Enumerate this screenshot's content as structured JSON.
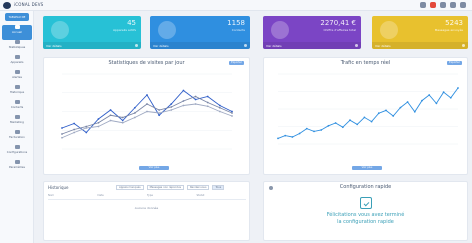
{
  "header": {
    "brand": "iCONAL DEVS",
    "icons": [
      "flag-icon",
      "bell-icon",
      "user-icon",
      "settings-icon",
      "logout-icon"
    ]
  },
  "sidebar": {
    "top_button": "TABLEAU DE BORD",
    "items": [
      {
        "label": "Accueil",
        "icon": "home-icon",
        "active": true
      },
      {
        "label": "Statistiques",
        "icon": "chart-icon",
        "active": false
      },
      {
        "label": "Appareils",
        "icon": "device-icon",
        "active": false
      },
      {
        "label": "Alertes",
        "icon": "alert-icon",
        "active": false
      },
      {
        "label": "Historique",
        "icon": "history-icon",
        "active": false
      },
      {
        "label": "Contacts",
        "icon": "contact-icon",
        "active": false
      },
      {
        "label": "Marketing",
        "icon": "megaphone-icon",
        "active": false
      },
      {
        "label": "Facturation",
        "icon": "invoice-icon",
        "active": false
      },
      {
        "label": "Configurations",
        "icon": "gear-icon",
        "active": false
      },
      {
        "label": "Paramètres",
        "icon": "sliders-icon",
        "active": false
      }
    ]
  },
  "cards": [
    {
      "value": "45",
      "desc": "Appareils actifs",
      "foot": "Voir détails",
      "color": "#27c1d6"
    },
    {
      "value": "1158",
      "desc": "Contacts",
      "foot": "Voir détails",
      "color": "#2f8fe0"
    },
    {
      "value": "2270,41 €",
      "desc": "Chiffre d'affaires total",
      "foot": "Voir détails",
      "color": "#7b45c5"
    },
    {
      "value": "5243",
      "desc": "Messages envoyés",
      "foot": "Voir détails",
      "color": "#e8c12e"
    }
  ],
  "panels": {
    "stats_title": "Statistiques de visites par jour",
    "stats_button": "Exporter",
    "stats_footer_button": "Voir plus",
    "traffic_title": "Trafic en temps réel",
    "traffic_button": "Exporter",
    "traffic_footer_button": "Voir plus",
    "history_title": "Historique",
    "history_tabs": [
      "Appels manqués",
      "Messages non répondus",
      "Rendez-vous",
      "Tous"
    ],
    "history_columns": [
      "Nom",
      "Date",
      "Type",
      "Statut"
    ],
    "history_empty": "Aucune donnée",
    "config_title": "Configuration rapide",
    "config_line1": "Félicitations vous avez terminé",
    "config_line2": "la configuration rapide"
  },
  "chart_data": [
    {
      "type": "line",
      "series": [
        {
          "values": [
            28,
            34,
            22,
            40,
            52,
            38,
            55,
            72,
            45,
            60,
            78,
            66,
            70,
            58,
            50
          ],
          "color": "#2f5ec9"
        },
        {
          "values": [
            20,
            26,
            30,
            35,
            45,
            42,
            48,
            60,
            52,
            56,
            64,
            70,
            62,
            55,
            48
          ],
          "color": "#7a86a6"
        },
        {
          "values": [
            15,
            22,
            28,
            30,
            38,
            35,
            42,
            50,
            48,
            52,
            58,
            60,
            57,
            50,
            44
          ],
          "color": "#9fa9c2"
        }
      ],
      "ylim": [
        0,
        100
      ]
    },
    {
      "type": "line",
      "series": [
        {
          "values": [
            8,
            12,
            10,
            15,
            22,
            18,
            20,
            26,
            30,
            24,
            34,
            28,
            38,
            32,
            44,
            48,
            40,
            52,
            60,
            46,
            62,
            70,
            58,
            74,
            66,
            80
          ],
          "color": "#2f8fe0"
        }
      ],
      "ylim": [
        0,
        100
      ]
    }
  ]
}
